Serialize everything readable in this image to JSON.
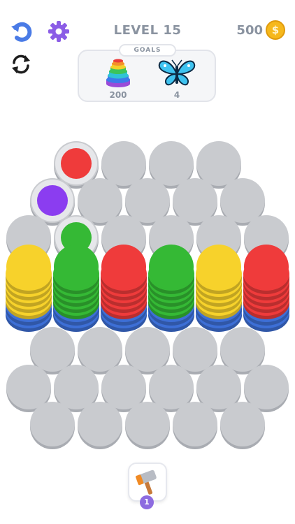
{
  "header": {
    "level_label": "LEVEL 15",
    "coins": "500",
    "coin_symbol": "$",
    "undo_icon": "undo-arrow-icon",
    "settings_icon": "gear-icon",
    "restart_icon": "restart-icon"
  },
  "goals": {
    "title": "GOALS",
    "items": [
      {
        "icon": "rainbow-stack-icon",
        "count": "200"
      },
      {
        "icon": "butterfly-icon",
        "count": "4"
      }
    ]
  },
  "board": {
    "tile_color": "#c9cbcf",
    "colors": {
      "red": "#ef3b3b",
      "yellow": "#f7d22b",
      "green": "#35b935",
      "blue": "#3d6fd6",
      "purple": "#8b3df0"
    },
    "single_chips": [
      {
        "row": 0,
        "col": 0,
        "color": "red"
      },
      {
        "row": 1,
        "col": 0,
        "color": "purple"
      },
      {
        "row": 2,
        "col": 1,
        "color": "green"
      }
    ],
    "stacks": [
      {
        "col": 0,
        "layers": [
          "blue",
          "blue",
          "yellow",
          "yellow",
          "yellow",
          "yellow",
          "yellow"
        ]
      },
      {
        "col": 1,
        "layers": [
          "blue",
          "blue",
          "green",
          "green",
          "green",
          "green",
          "green"
        ]
      },
      {
        "col": 2,
        "layers": [
          "blue",
          "blue",
          "red",
          "red",
          "red",
          "red",
          "red"
        ]
      },
      {
        "col": 3,
        "layers": [
          "blue",
          "blue",
          "green",
          "green",
          "green",
          "green",
          "green"
        ]
      },
      {
        "col": 4,
        "layers": [
          "blue",
          "blue",
          "yellow",
          "yellow",
          "yellow",
          "yellow",
          "yellow"
        ]
      },
      {
        "col": 5,
        "layers": [
          "blue",
          "blue",
          "red",
          "red",
          "red",
          "red",
          "red"
        ]
      }
    ]
  },
  "booster": {
    "icon": "hammer-icon",
    "count": "1"
  }
}
